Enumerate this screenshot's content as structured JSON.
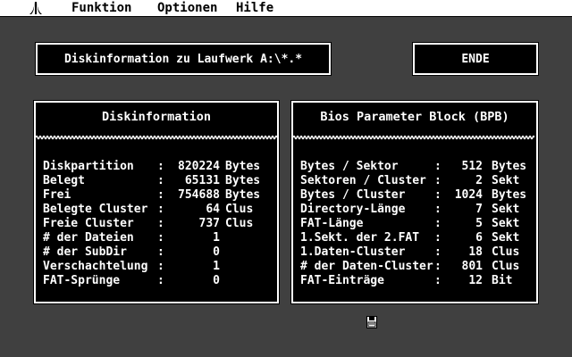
{
  "menu": [
    "Funktion",
    "Optionen",
    "Hilfe"
  ],
  "title_text": "Diskinformation zu Laufwerk A:\\*.*",
  "ende_label": "ENDE",
  "left_panel": {
    "title": "Diskinformation",
    "rows": [
      {
        "label": "Diskpartition",
        "sep": ":",
        "value": "820224",
        "unit": "Bytes"
      },
      {
        "label": "Belegt",
        "sep": ":",
        "value": "65131",
        "unit": "Bytes"
      },
      {
        "label": "Frei",
        "sep": ":",
        "value": "754688",
        "unit": "Bytes"
      },
      {
        "label": "Belegte Cluster",
        "sep": ":",
        "value": "64",
        "unit": "Clus"
      },
      {
        "label": "Freie Cluster",
        "sep": ":",
        "value": "737",
        "unit": "Clus"
      },
      {
        "label": "# der Dateien",
        "sep": ":",
        "value": "1",
        "unit": ""
      },
      {
        "label": "# der SubDir",
        "sep": ":",
        "value": "0",
        "unit": ""
      },
      {
        "label": "Verschachtelung",
        "sep": ":",
        "value": "1",
        "unit": ""
      },
      {
        "label": "FAT-Sprünge",
        "sep": ":",
        "value": "0",
        "unit": ""
      }
    ]
  },
  "right_panel": {
    "title": "Bios Parameter Block (BPB)",
    "rows": [
      {
        "label": "Bytes / Sektor",
        "sep": ":",
        "value": "512",
        "unit": "Bytes"
      },
      {
        "label": "Sektoren / Cluster",
        "sep": ":",
        "value": "2",
        "unit": "Sekt"
      },
      {
        "label": "Bytes / Cluster",
        "sep": ":",
        "value": "1024",
        "unit": "Bytes"
      },
      {
        "label": "Directory-Länge",
        "sep": ":",
        "value": "7",
        "unit": "Sekt"
      },
      {
        "label": "FAT-Länge",
        "sep": ":",
        "value": "5",
        "unit": "Sekt"
      },
      {
        "label": "1.Sekt. der 2.FAT",
        "sep": ":",
        "value": "6",
        "unit": "Sekt"
      },
      {
        "label": "1.Daten-Cluster",
        "sep": ":",
        "value": "18",
        "unit": "Clus"
      },
      {
        "label": "# der Daten-Cluster",
        "sep": ":",
        "value": "801",
        "unit": "Clus"
      },
      {
        "label": "FAT-Einträge",
        "sep": ":",
        "value": "12",
        "unit": "Bit"
      }
    ]
  }
}
